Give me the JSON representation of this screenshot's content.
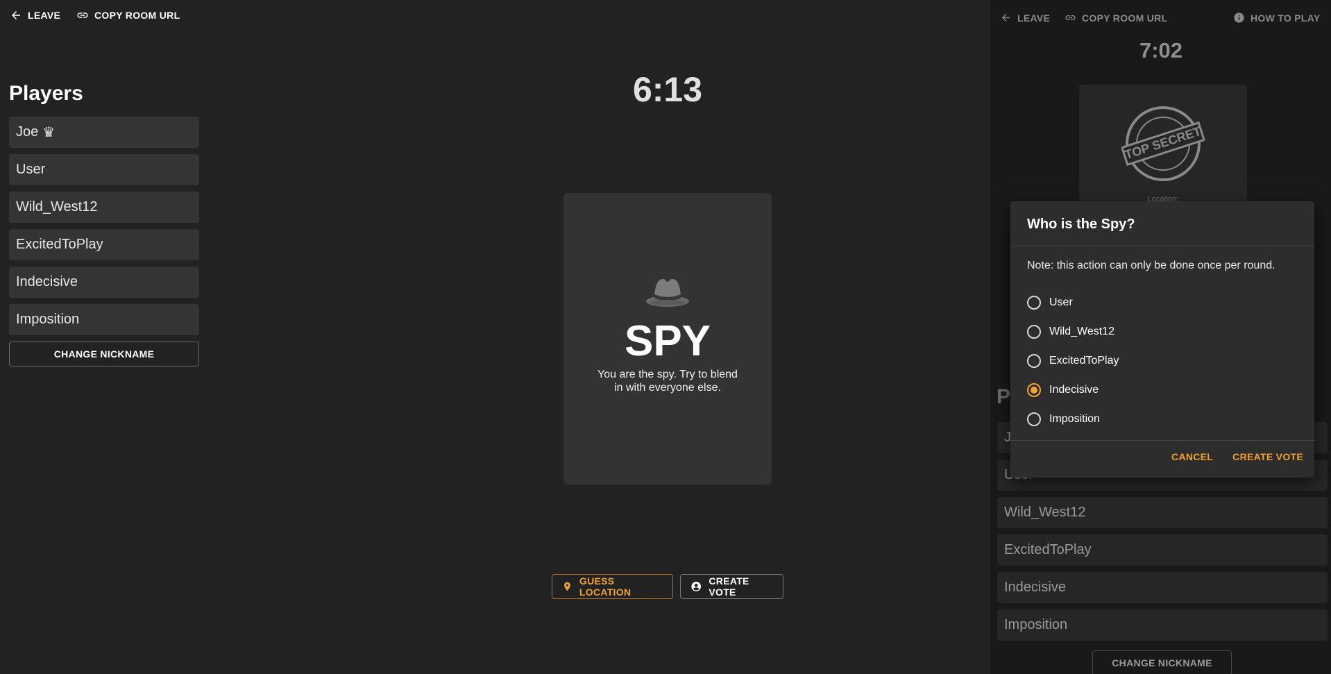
{
  "topbar": {
    "leave_label": "LEAVE",
    "copy_url_label": "COPY ROOM URL"
  },
  "timer": "6:13",
  "players": {
    "title": "Players",
    "items": [
      {
        "name": "Joe",
        "host": true
      },
      {
        "name": "User"
      },
      {
        "name": "Wild_West12"
      },
      {
        "name": "ExcitedToPlay"
      },
      {
        "name": "Indecisive"
      },
      {
        "name": "Imposition"
      }
    ],
    "change_nickname_label": "CHANGE NICKNAME",
    "crown_icon": "crown-icon"
  },
  "role_card": {
    "icon": "spy-hat-icon",
    "title": "SPY",
    "description": "You are the spy. Try to blend in with everyone else."
  },
  "actions": {
    "guess_location_label": "GUESS LOCATION",
    "create_vote_label": "CREATE VOTE"
  },
  "other_view": {
    "leave_label": "LEAVE",
    "copy_url_label": "COPY ROOM URL",
    "how_to_play_label": "HOW TO PLAY",
    "timer": "7:02",
    "stamp_text": "TOP SECRET",
    "location_label": "Location:",
    "players_title_partial": "P",
    "players": [
      "J",
      "User",
      "Wild_West12",
      "ExcitedToPlay",
      "Indecisive",
      "Imposition"
    ],
    "change_nickname_label": "CHANGE NICKNAME"
  },
  "vote_dialog": {
    "title": "Who is the Spy?",
    "note": "Note: this action can only be done once per round.",
    "options": [
      {
        "label": "User",
        "selected": false
      },
      {
        "label": "Wild_West12",
        "selected": false
      },
      {
        "label": "ExcitedToPlay",
        "selected": false
      },
      {
        "label": "Indecisive",
        "selected": true
      },
      {
        "label": "Imposition",
        "selected": false
      }
    ],
    "cancel_label": "CANCEL",
    "create_vote_label": "CREATE VOTE"
  },
  "colors": {
    "background": "#222222",
    "accent": "#f3a12f",
    "card": "#333333"
  }
}
